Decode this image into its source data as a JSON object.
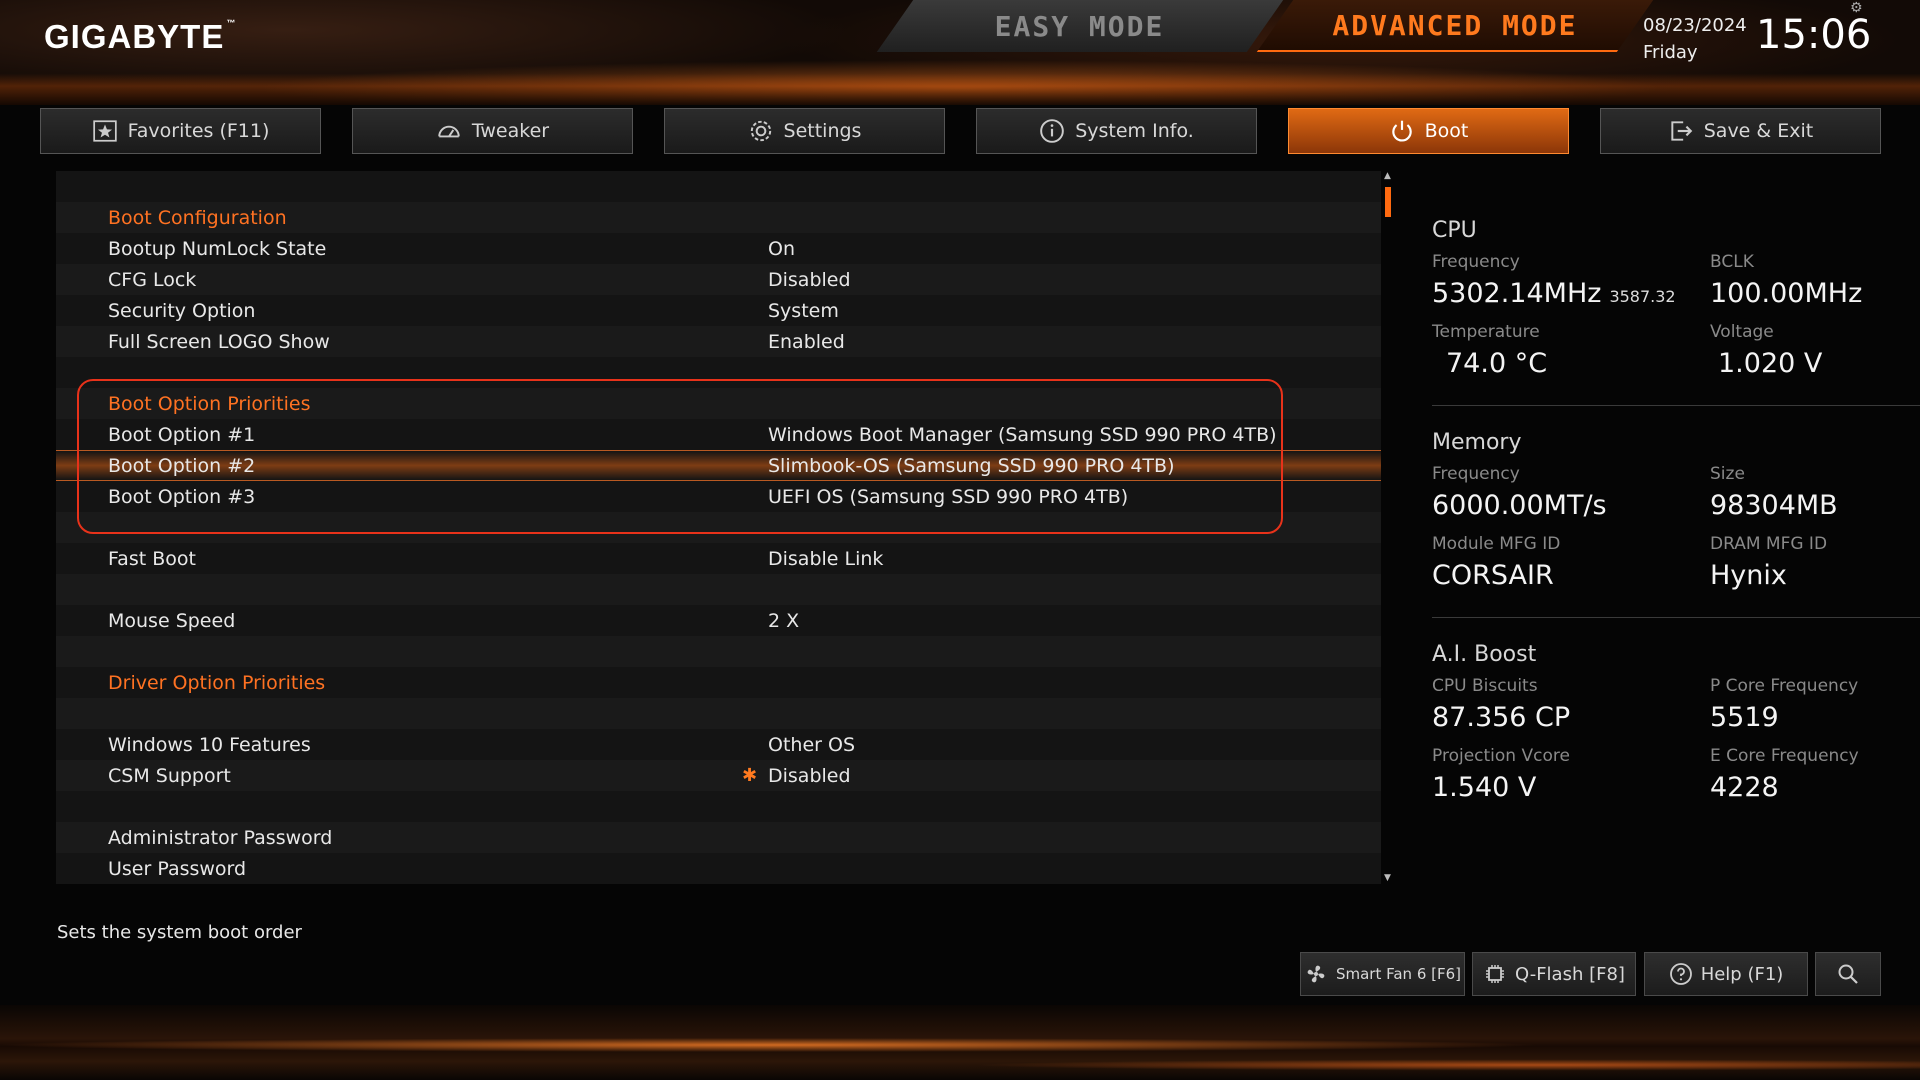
{
  "brand": {
    "logo": "GIGABYTE",
    "tm": "™"
  },
  "modes": {
    "easy": "EASY MODE",
    "advanced": "ADVANCED MODE"
  },
  "datetime": {
    "date": "08/23/2024",
    "day": "Friday",
    "time": "15:06"
  },
  "tabs": [
    {
      "label": "Favorites (F11)",
      "icon": "star-icon"
    },
    {
      "label": "Tweaker",
      "icon": "speedometer-icon"
    },
    {
      "label": "Settings",
      "icon": "gear-icon"
    },
    {
      "label": "System Info.",
      "icon": "info-icon"
    },
    {
      "label": "Boot",
      "icon": "power-icon",
      "active": true
    },
    {
      "label": "Save & Exit",
      "icon": "exit-icon"
    }
  ],
  "list": {
    "rows": [
      {
        "type": "blank"
      },
      {
        "type": "header",
        "label": "Boot Configuration"
      },
      {
        "type": "item",
        "label": "Bootup NumLock State",
        "value": "On"
      },
      {
        "type": "item",
        "label": "CFG Lock",
        "value": "Disabled"
      },
      {
        "type": "item",
        "label": "Security Option",
        "value": "System"
      },
      {
        "type": "item",
        "label": "Full Screen LOGO Show",
        "value": "Enabled"
      },
      {
        "type": "blank"
      },
      {
        "type": "header",
        "label": "Boot Option Priorities"
      },
      {
        "type": "item",
        "label": "Boot Option #1",
        "value": "Windows Boot Manager (Samsung SSD 990 PRO 4TB)"
      },
      {
        "type": "item",
        "label": "Boot Option #2",
        "value": "Slimbook-OS (Samsung SSD 990 PRO 4TB)",
        "selected": true
      },
      {
        "type": "item",
        "label": "Boot Option #3",
        "value": "UEFI OS (Samsung SSD 990 PRO 4TB)"
      },
      {
        "type": "blank"
      },
      {
        "type": "item",
        "label": "Fast Boot",
        "value": "Disable Link"
      },
      {
        "type": "blank"
      },
      {
        "type": "item",
        "label": "Mouse Speed",
        "value": "2 X"
      },
      {
        "type": "blank"
      },
      {
        "type": "header",
        "label": "Driver Option Priorities"
      },
      {
        "type": "blank"
      },
      {
        "type": "item",
        "label": "Windows 10 Features",
        "value": "Other OS"
      },
      {
        "type": "item",
        "label": "CSM Support",
        "value": "Disabled",
        "star": true
      },
      {
        "type": "blank"
      },
      {
        "type": "item",
        "label": "Administrator Password",
        "value": ""
      },
      {
        "type": "item",
        "label": "User Password",
        "value": ""
      }
    ]
  },
  "info": {
    "cpu": {
      "title": "CPU",
      "frequency_label": "Frequency",
      "frequency": "5302.14MHz",
      "frequency_sub": "3587.32",
      "bclk_label": "BCLK",
      "bclk": "100.00MHz",
      "temp_label": "Temperature",
      "temp": "74.0 °C",
      "voltage_label": "Voltage",
      "voltage": "1.020 V"
    },
    "memory": {
      "title": "Memory",
      "frequency_label": "Frequency",
      "frequency": "6000.00MT/s",
      "size_label": "Size",
      "size": "98304MB",
      "module_label": "Module MFG ID",
      "module": "CORSAIR",
      "dram_label": "DRAM MFG ID",
      "dram": "Hynix"
    },
    "aiboost": {
      "title": "A.I. Boost",
      "biscuits_label": "CPU Biscuits",
      "biscuits": "87.356 CP",
      "pcore_label": "P Core Frequency",
      "pcore": "5519",
      "vcore_label": "Projection Vcore",
      "vcore": "1.540 V",
      "ecore_label": "E Core Frequency",
      "ecore": "4228"
    }
  },
  "hint": "Sets the system boot order",
  "footer": {
    "smartfan": "Smart Fan 6 [F6]",
    "qflash": "Q-Flash [F8]",
    "help": "Help (F1)"
  },
  "colors": {
    "accent": "#ff7222",
    "highlight_box": "#e8321a"
  }
}
